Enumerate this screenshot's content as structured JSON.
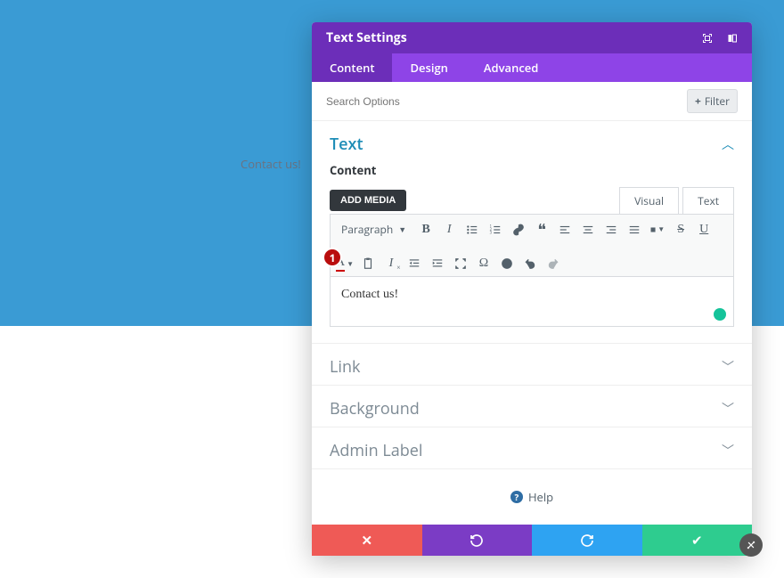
{
  "colors": {
    "header": "#6c2eb9",
    "tabs": "#8e44e7",
    "accent": "#1e8db7",
    "red": "#ef5a56",
    "blue": "#2ea3f2",
    "green": "#2ecc8f"
  },
  "preview_text": "Contact us!",
  "modal": {
    "title": "Text Settings",
    "tabs": {
      "content": "Content",
      "design": "Design",
      "advanced": "Advanced"
    },
    "search_placeholder": "Search Options",
    "filter_label": "Filter"
  },
  "sections": {
    "text": "Text",
    "content_label": "Content",
    "link": "Link",
    "background": "Background",
    "admin_label": "Admin Label"
  },
  "editor": {
    "add_media": "ADD MEDIA",
    "visual_tab": "Visual",
    "text_tab": "Text",
    "format_label": "Paragraph",
    "body_text": "Contact us!"
  },
  "badge_number": "1",
  "help_label": "Help"
}
